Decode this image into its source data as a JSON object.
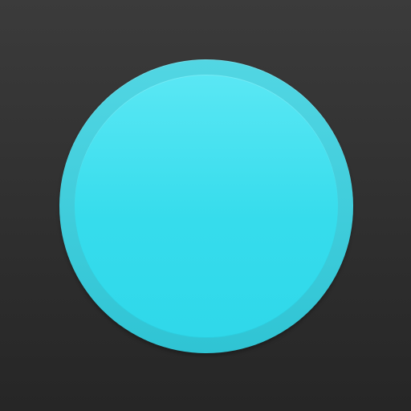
{
  "icon": {
    "shape": "circle",
    "background_color": "#2f2f2f",
    "outer_ring_color": "#3ccbda",
    "inner_circle_color": "#39ddee"
  }
}
